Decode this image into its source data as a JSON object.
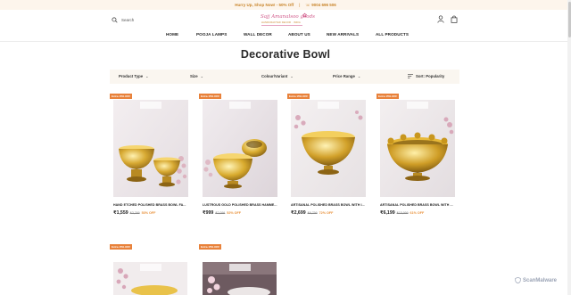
{
  "announcement": {
    "text": "Hurry Up, Shop Now! - 50% Off",
    "sep": "|",
    "phone": "☏ 9004 696 506"
  },
  "header": {
    "search_placeholder": "Search",
    "logo_text": "Sajj Amanalsoo goods",
    "logo_tagline": "HANDCRAFTED DECOR · INDIA"
  },
  "nav": {
    "items": [
      {
        "label": "HOME"
      },
      {
        "label": "POOJA LAMPS"
      },
      {
        "label": "WALL DECOR"
      },
      {
        "label": "ABOUT US"
      },
      {
        "label": "NEW ARRIVALS"
      },
      {
        "label": "ALL PRODUCTS"
      }
    ]
  },
  "page": {
    "title": "Decorative Bowl"
  },
  "filters": {
    "product_type": "Product Type",
    "size": "Size",
    "colour": "Colour/Variant",
    "price": "Price Range",
    "sort": "Sort: Popularity"
  },
  "products": [
    {
      "badge": "Extra 15% OFF",
      "name": "HAND ETCHED POLISHED BRASS BOWL FA...",
      "price_now": "₹1,559",
      "price_old": "₹3,299",
      "discount": "53% OFF"
    },
    {
      "badge": "Extra 15% OFF",
      "name": "LUSTROUS GOLD POLISHED BRASS HAMME...",
      "price_now": "₹999",
      "price_old": "₹2,099",
      "discount": "52% OFF"
    },
    {
      "badge": "Extra 15% OFF",
      "name": "ARTISANAL POLISHED BRASS BOWL WITH I...",
      "price_now": "₹2,699",
      "price_old": "₹9,799",
      "discount": "72% OFF"
    },
    {
      "badge": "Extra 15% OFF",
      "name": "ARTISANAL POLISHED BRASS BOWL WITH ...",
      "price_now": "₹6,199",
      "price_old": "₹15,999",
      "discount": "61% OFF"
    },
    {
      "badge": "Extra 15% OFF",
      "name": "",
      "price_now": "",
      "price_old": "",
      "discount": ""
    },
    {
      "badge": "Extra 15% OFF",
      "name": "",
      "price_now": "",
      "price_old": "",
      "discount": ""
    }
  ],
  "watermark": {
    "text": "ScanMalware"
  },
  "colors": {
    "accent": "#e8913a",
    "badge": "#e8813a",
    "brand_pink": "#d15a8a",
    "announce_bg": "#fdf5ec",
    "filter_bg": "#faf6f0"
  },
  "icons": [
    "search-icon",
    "user-icon",
    "shopping-bag-icon",
    "chevron-down-icon",
    "sort-icon",
    "shield-icon"
  ]
}
